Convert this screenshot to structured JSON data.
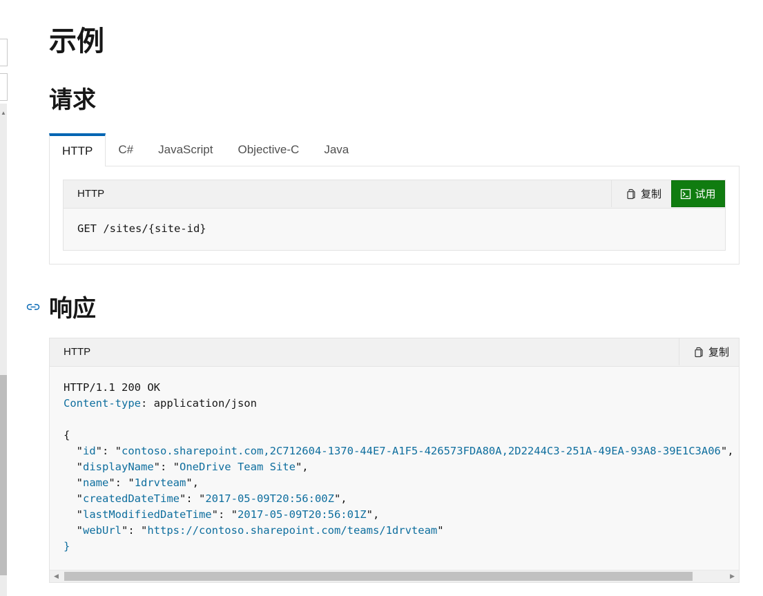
{
  "headings": {
    "examples": "示例",
    "request": "请求",
    "response": "响应"
  },
  "tabs": [
    {
      "label": "HTTP",
      "active": true
    },
    {
      "label": "C#",
      "active": false
    },
    {
      "label": "JavaScript",
      "active": false
    },
    {
      "label": "Objective-C",
      "active": false
    },
    {
      "label": "Java",
      "active": false
    }
  ],
  "request_block": {
    "language": "HTTP",
    "copy_label": "复制",
    "try_label": "试用",
    "code": "GET /sites/{site-id}"
  },
  "response_block": {
    "language": "HTTP",
    "copy_label": "复制",
    "status_line": "HTTP/1.1 200 OK",
    "header_name": "Content-type",
    "header_value": "application/json",
    "open_brace": "{",
    "close_brace": "}",
    "fields": [
      {
        "key": "id",
        "value": "contoso.sharepoint.com,2C712604-1370-44E7-A1F5-426573FDA80A,2D2244C3-251A-49EA-93A8-39E1C3A06",
        "last": false
      },
      {
        "key": "displayName",
        "value": "OneDrive Team Site",
        "last": false
      },
      {
        "key": "name",
        "value": "1drvteam",
        "last": false
      },
      {
        "key": "createdDateTime",
        "value": "2017-05-09T20:56:00Z",
        "last": false
      },
      {
        "key": "lastModifiedDateTime",
        "value": "2017-05-09T20:56:01Z",
        "last": false
      },
      {
        "key": "webUrl",
        "value": "https://contoso.sharepoint.com/teams/1drvteam",
        "last": true
      }
    ]
  },
  "colors": {
    "accent": "#0065b3",
    "try_button": "#107c10",
    "code_key": "#0e6e9e"
  },
  "icons": {
    "copy": "copy-icon",
    "try": "terminal-icon",
    "anchor": "link-icon"
  }
}
